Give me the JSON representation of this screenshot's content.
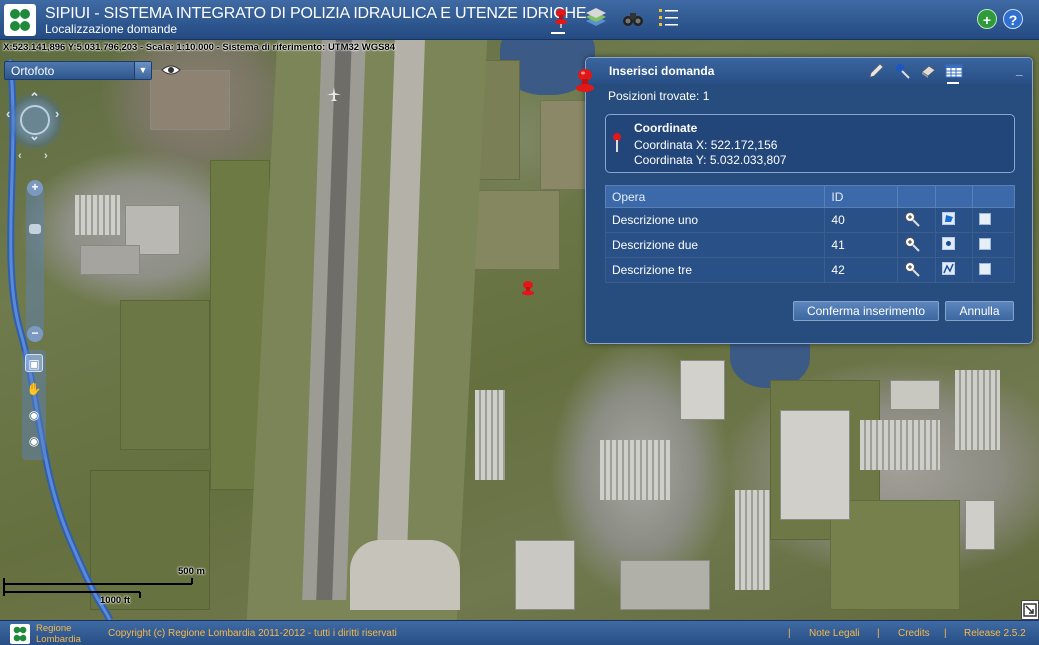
{
  "app": {
    "title": "SIPIUI - SISTEMA INTEGRATO DI POLIZIA IDRAULICA E UTENZE IDRICHE",
    "subtitle": "Localizzazione domande"
  },
  "status_line": "X:523.141,896 Y:5.031.796,203 - Scala: 1:10.000 - Sistema di riferimento: UTM32 WGS84",
  "layer_selector": {
    "selected": "Ortofoto"
  },
  "header_icons": [
    "pin-icon",
    "layers-icon",
    "binoculars-icon",
    "list-icon",
    "add-icon",
    "help-icon"
  ],
  "scale": {
    "metric": "500 m",
    "imperial": "1000 ft"
  },
  "panel": {
    "title": "Inserisci domanda",
    "positions_found": "Posizioni trovate: 1",
    "coordinates": {
      "title": "Coordinate",
      "x": "Coordinata X: 522.172,156",
      "y": "Coordinata Y: 5.032.033,807"
    },
    "table": {
      "headers": [
        "Opera",
        "ID",
        "",
        "",
        ""
      ],
      "rows": [
        {
          "opera": "Descrizione uno",
          "id": "40",
          "geometry": "polygon"
        },
        {
          "opera": "Descrizione due",
          "id": "41",
          "geometry": "point"
        },
        {
          "opera": "Descrizione tre",
          "id": "42",
          "geometry": "line"
        }
      ]
    },
    "confirm_button": "Conferma inserimento",
    "cancel_button": "Annulla"
  },
  "footer": {
    "region_line1": "Regione",
    "region_line2": "Lombardia",
    "copyright": "Copyright (c) Regione Lombardia 2011-2012 - tutti i diritti riservati",
    "links": [
      "Note Legali",
      "Credits",
      "Release 2.5.2"
    ],
    "link_color": "#f6b94a"
  },
  "colors": {
    "header": "#2f5a94",
    "panel": "#274c7e",
    "accent_red": "#e02020"
  }
}
